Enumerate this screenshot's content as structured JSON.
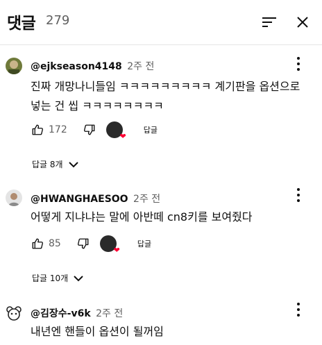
{
  "header": {
    "title": "댓글",
    "count": "279"
  },
  "comments": [
    {
      "author": "@ejkseason4148",
      "time": "2주 전",
      "text": "진짜 개망나니들임 ㅋㅋㅋㅋㅋㅋㅋㅋㅋ 계기판을 옵션으로 넣는 건 씹 ㅋㅋㅋㅋㅋㅋㅋㅋ",
      "likes": "172",
      "reply_label": "답글",
      "replies_label": "답글 8개"
    },
    {
      "author": "@HWANGHAESOO",
      "time": "2주 전",
      "text": "어떻게 지냐냐는 말에 아반떼 cn8키를 보여줬다",
      "likes": "85",
      "reply_label": "답글",
      "replies_label": "답글 10개"
    },
    {
      "author": "@김장수-v6k",
      "time": "2주 전",
      "text": "내년엔 핸들이 옵션이 될꺼임"
    }
  ],
  "icons": {
    "sort": "sort-icon",
    "close": "close-icon",
    "more": "more-vert-icon",
    "like": "thumb-up-icon",
    "dislike": "thumb-down-icon",
    "chevron": "chevron-down-icon",
    "heart": "heart-icon"
  },
  "colors": {
    "heart": "#ff0033",
    "secondary_text": "#606060",
    "divider": "#e5e5e5"
  }
}
